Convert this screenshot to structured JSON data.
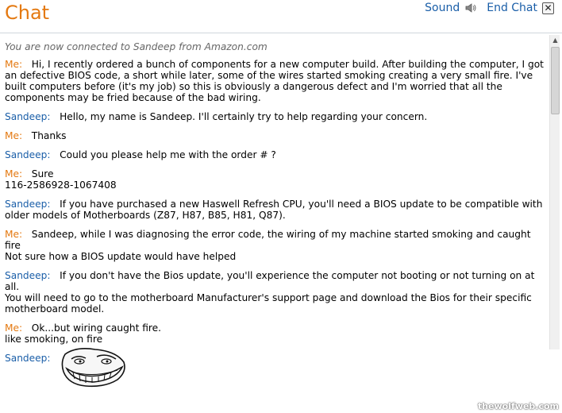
{
  "header": {
    "title": "Chat",
    "sound_label": "Sound",
    "end_chat_label": "End Chat",
    "accent": "#e47911"
  },
  "transcript": {
    "system_notice": "You are now connected to Sandeep from Amazon.com",
    "messages": [
      {
        "speaker": "Me:",
        "text": "Hi, I recently ordered a bunch of components for a new computer build. After building the computer, I got an defective BIOS code, a short while later, some of the wires started smoking creating a very small fire. I've built computers before (it's my job) so this is obviously a dangerous defect and I'm worried that all the components may be fried because of the bad wiring."
      },
      {
        "speaker": "Sandeep:",
        "text": "Hello, my name is Sandeep. I'll certainly try to help regarding your concern."
      },
      {
        "speaker": "Me:",
        "text": "Thanks"
      },
      {
        "speaker": "Sandeep:",
        "text": "Could you please help me with the order # ?"
      },
      {
        "speaker": "Me:",
        "text": "Sure\n116-2586928-1067408"
      },
      {
        "speaker": "Sandeep:",
        "text": "If you have purchased a new Haswell Refresh CPU, you'll need a BIOS update to be compatible with older models of Motherboards (Z87, H87, B85, H81, Q87)."
      },
      {
        "speaker": "Me:",
        "text": "Sandeep, while I was diagnosing the error code, the wiring of my machine started smoking and caught fire\nNot sure how a BIOS update would have helped"
      },
      {
        "speaker": "Sandeep:",
        "text": "If you don't have the Bios update, you'll experience the computer not booting or not turning on at all.\nYou will need to go to the motherboard Manufacturer's support page and download the Bios for their specific motherboard model."
      },
      {
        "speaker": "Me:",
        "text": "Ok...but wiring caught fire.\nlike smoking, on fire"
      },
      {
        "speaker": "Sandeep:",
        "text": ""
      }
    ]
  },
  "watermark": "thewolfweb.com",
  "icons": {
    "sound": "speaker-icon",
    "close": "close-icon"
  }
}
